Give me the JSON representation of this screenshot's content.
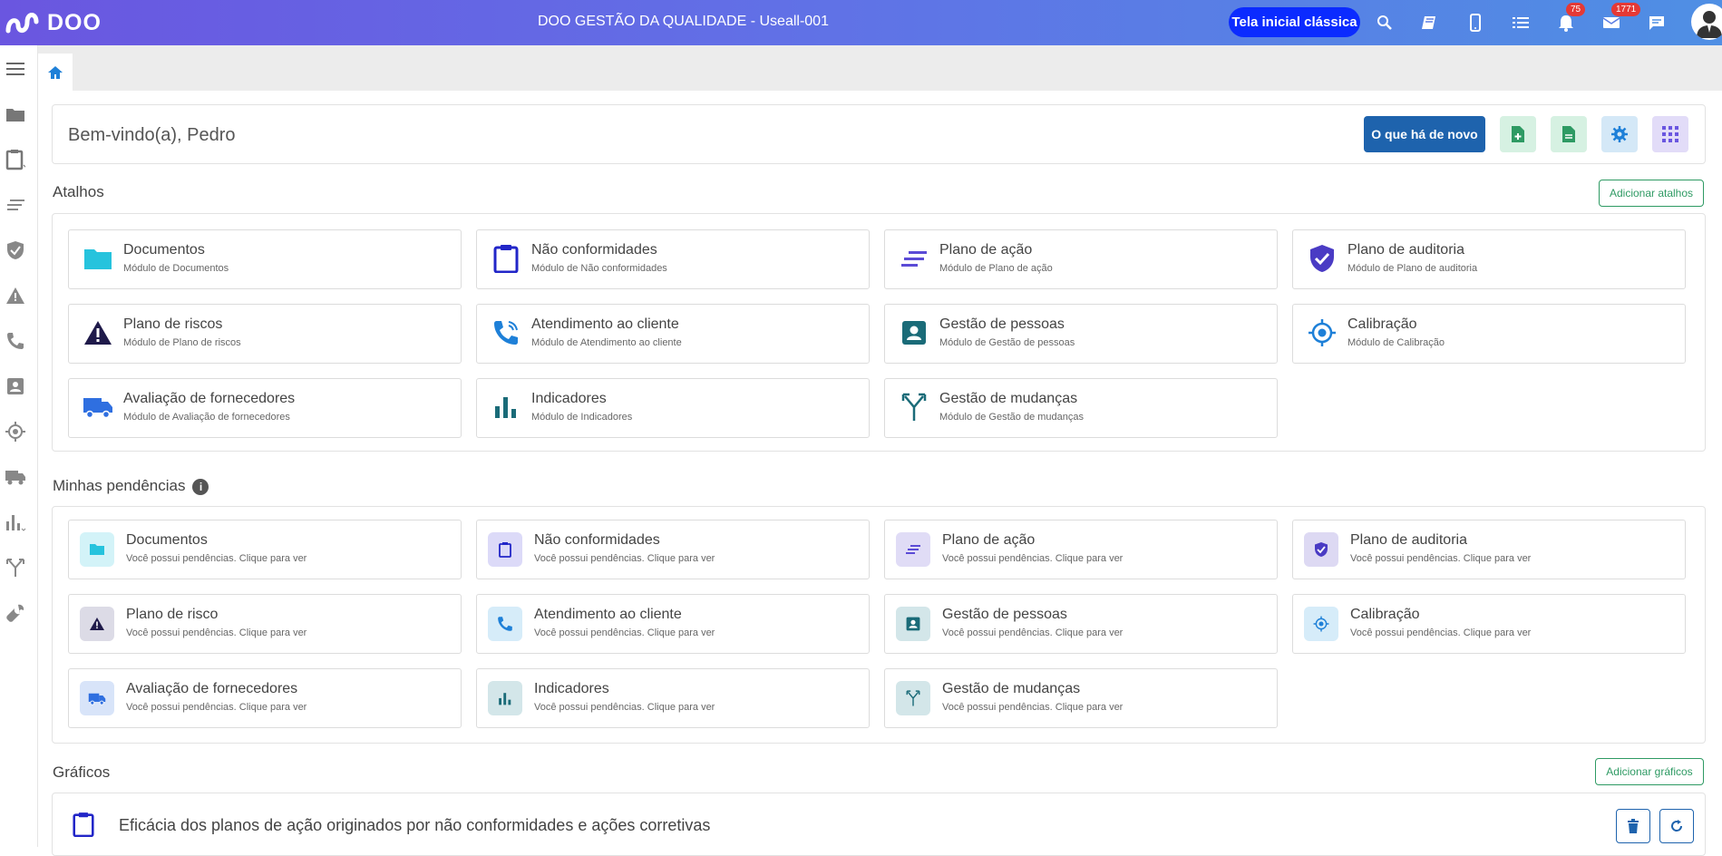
{
  "header": {
    "brand": "DOO",
    "title": "DOO GESTÃO DA QUALIDADE - Useall-001",
    "classic_home": "Tela inicial clássica",
    "notifications_count": "75",
    "messages_count": "1771"
  },
  "welcome": {
    "text": "Bem-vindo(a), Pedro",
    "whats_new": "O que há de novo"
  },
  "shortcuts": {
    "title": "Atalhos",
    "add_label": "Adicionar atalhos",
    "items": [
      {
        "title": "Documentos",
        "subtitle": "Módulo de Documentos",
        "icon": "folder-icon"
      },
      {
        "title": "Não conformidades",
        "subtitle": "Módulo de Não conformidades",
        "icon": "clipboard-icon"
      },
      {
        "title": "Plano de ação",
        "subtitle": "Módulo de Plano de ação",
        "icon": "lines-icon"
      },
      {
        "title": "Plano de auditoria",
        "subtitle": "Módulo de Plano de auditoria",
        "icon": "shield-check-icon"
      },
      {
        "title": "Plano de riscos",
        "subtitle": "Módulo de Plano de riscos",
        "icon": "warning-icon"
      },
      {
        "title": "Atendimento ao cliente",
        "subtitle": "Módulo de Atendimento ao cliente",
        "icon": "phone-icon"
      },
      {
        "title": "Gestão de pessoas",
        "subtitle": "Módulo de Gestão de pessoas",
        "icon": "person-card-icon"
      },
      {
        "title": "Calibração",
        "subtitle": "Módulo de Calibração",
        "icon": "target-icon"
      },
      {
        "title": "Avaliação de fornecedores",
        "subtitle": "Módulo de Avaliação de fornecedores",
        "icon": "truck-icon"
      },
      {
        "title": "Indicadores",
        "subtitle": "Módulo de Indicadores",
        "icon": "bar-chart-icon"
      },
      {
        "title": "Gestão de mudanças",
        "subtitle": "Módulo de Gestão de mudanças",
        "icon": "merge-icon"
      }
    ]
  },
  "pending": {
    "title": "Minhas pendências",
    "items": [
      {
        "title": "Documentos",
        "subtitle": "Você possui pendências. Clique para ver",
        "icon": "folder-icon"
      },
      {
        "title": "Não conformidades",
        "subtitle": "Você possui pendências. Clique para ver",
        "icon": "clipboard-icon"
      },
      {
        "title": "Plano de ação",
        "subtitle": "Você possui pendências. Clique para ver",
        "icon": "lines-icon"
      },
      {
        "title": "Plano de auditoria",
        "subtitle": "Você possui pendências. Clique para ver",
        "icon": "shield-check-icon"
      },
      {
        "title": "Plano de risco",
        "subtitle": "Você possui pendências. Clique para ver",
        "icon": "warning-icon"
      },
      {
        "title": "Atendimento ao cliente",
        "subtitle": "Você possui pendências. Clique para ver",
        "icon": "phone-icon"
      },
      {
        "title": "Gestão de pessoas",
        "subtitle": "Você possui pendências. Clique para ver",
        "icon": "person-card-icon"
      },
      {
        "title": "Calibração",
        "subtitle": "Você possui pendências. Clique para ver",
        "icon": "target-icon"
      },
      {
        "title": "Avaliação de fornecedores",
        "subtitle": "Você possui pendências. Clique para ver",
        "icon": "truck-icon"
      },
      {
        "title": "Indicadores",
        "subtitle": "Você possui pendências. Clique para ver",
        "icon": "bar-chart-icon"
      },
      {
        "title": "Gestão de mudanças",
        "subtitle": "Você possui pendências. Clique para ver",
        "icon": "merge-icon"
      }
    ]
  },
  "charts": {
    "title": "Gráficos",
    "add_label": "Adicionar gráficos",
    "first_chart_title": "Eficácia dos planos de ação originados por não conformidades e ações corretivas"
  },
  "colors": {
    "primary": "#1e63ad",
    "accent_green": "#2e9a63",
    "header_start": "#6a56e0",
    "header_end": "#4f8fe4"
  }
}
